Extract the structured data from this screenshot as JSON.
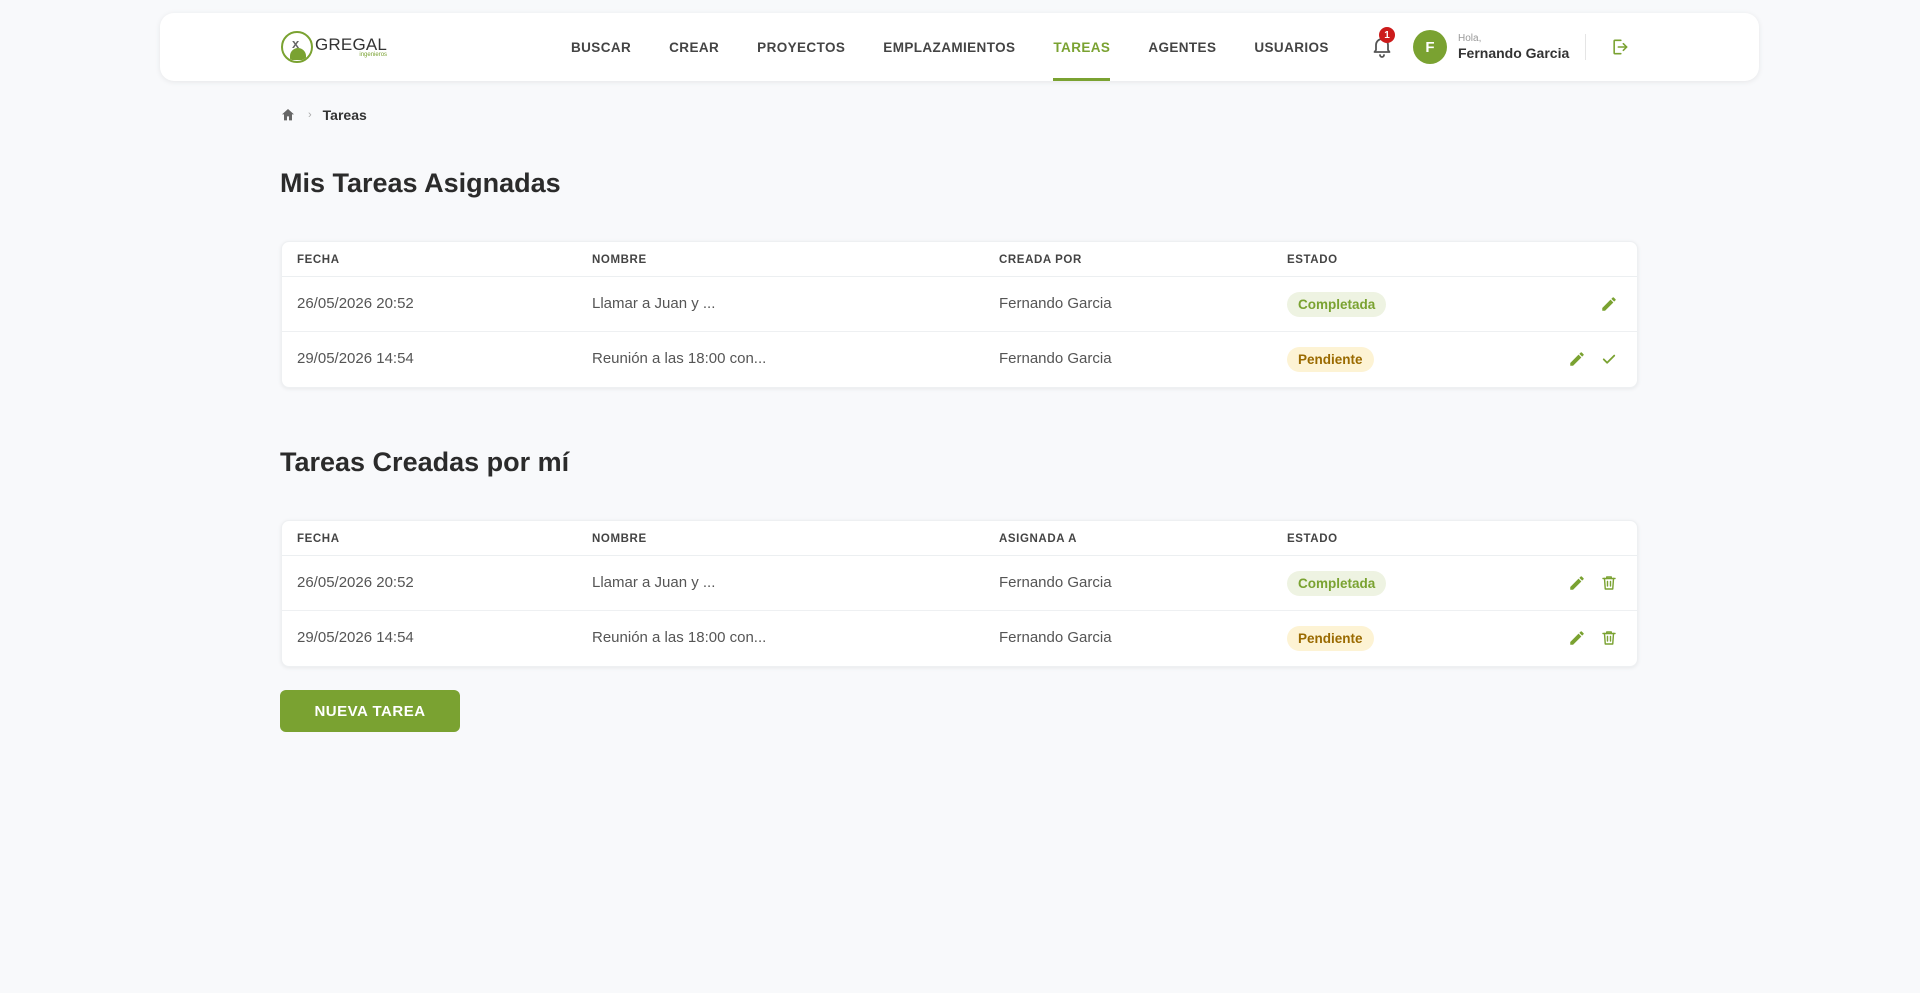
{
  "header": {
    "logo_name": "GREGAL",
    "logo_sub": "ingenieros",
    "nav": [
      {
        "label": "BUSCAR",
        "active": false
      },
      {
        "label": "CREAR",
        "active": false
      },
      {
        "label": "PROYECTOS",
        "active": false
      },
      {
        "label": "EMPLAZAMIENTOS",
        "active": false
      },
      {
        "label": "TAREAS",
        "active": true
      },
      {
        "label": "AGENTES",
        "active": false
      },
      {
        "label": "USUARIOS",
        "active": false
      }
    ],
    "notifications_count": "1",
    "avatar_initial": "F",
    "greeting": "Hola,",
    "user_name": "Fernando Garcia"
  },
  "breadcrumb": {
    "home_icon": "home-icon",
    "current": "Tareas"
  },
  "assigned": {
    "title": "Mis Tareas Asignadas",
    "columns": [
      "FECHA",
      "NOMBRE",
      "CREADA POR",
      "ESTADO"
    ],
    "rows": [
      {
        "fecha": "26/05/2026 20:52",
        "nombre": "Llamar a Juan y ...",
        "persona": "Fernando Garcia",
        "estado": "Completada",
        "status": "done",
        "actions": [
          "edit"
        ]
      },
      {
        "fecha": "29/05/2026 14:54",
        "nombre": "Reunión a las 18:00 con...",
        "persona": "Fernando Garcia",
        "estado": "Pendiente",
        "status": "pending",
        "actions": [
          "edit",
          "check"
        ]
      }
    ]
  },
  "created": {
    "title": "Tareas Creadas por mí",
    "columns": [
      "FECHA",
      "NOMBRE",
      "ASIGNADA A",
      "ESTADO"
    ],
    "rows": [
      {
        "fecha": "26/05/2026 20:52",
        "nombre": "Llamar a Juan y ...",
        "persona": "Fernando Garcia",
        "estado": "Completada",
        "status": "done",
        "actions": [
          "edit",
          "delete"
        ]
      },
      {
        "fecha": "29/05/2026 14:54",
        "nombre": "Reunión a las 18:00 con...",
        "persona": "Fernando Garcia",
        "estado": "Pendiente",
        "status": "pending",
        "actions": [
          "edit",
          "delete"
        ]
      }
    ]
  },
  "new_task_button": "NUEVA TAREA",
  "colors": {
    "accent": "#7aa231",
    "badge_red": "#cc1b1b",
    "pending_bg": "#fdf3d4",
    "pending_text": "#9a6a00",
    "done_bg": "#eef3e2"
  }
}
